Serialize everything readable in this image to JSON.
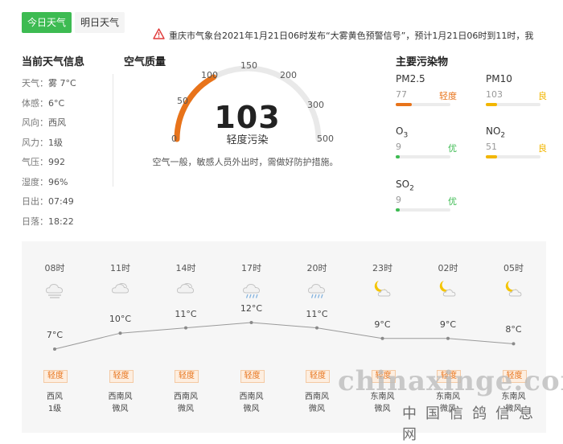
{
  "tabs": {
    "today": "今日天气",
    "tomorrow": "明日天气"
  },
  "alert": {
    "text": "重庆市气象台2021年1月21日06时发布“大雾黄色预警信号”，预计1月21日06时到11时，我"
  },
  "current": {
    "title": "当前天气信息",
    "rows": [
      {
        "label": "天气：",
        "value": "雾 7°C"
      },
      {
        "label": "体感：",
        "value": "6°C"
      },
      {
        "label": "风向：",
        "value": "西风"
      },
      {
        "label": "风力：",
        "value": "1级"
      },
      {
        "label": "气压：",
        "value": "992"
      },
      {
        "label": "湿度：",
        "value": "96%"
      },
      {
        "label": "日出：",
        "value": "07:49"
      },
      {
        "label": "日落：",
        "value": "18:22"
      }
    ]
  },
  "aqi": {
    "title": "空气质量",
    "value": "103",
    "level": "轻度污染",
    "description": "空气一般，敏感人员外出时，需做好防护措施。",
    "ticks": [
      "0",
      "50",
      "100",
      "150",
      "200",
      "300",
      "500"
    ],
    "gauge_fraction": 0.34,
    "accent": "#e8731a"
  },
  "pollutants": {
    "title": "主要污染物",
    "items": [
      {
        "name": "PM2.5",
        "value": "77",
        "level": "轻度",
        "level_color": "#e8731a",
        "fill": 0.3
      },
      {
        "name": "PM10",
        "value": "103",
        "level": "良",
        "level_color": "#f2b600",
        "fill": 0.2
      },
      {
        "name": "O",
        "sub": "3",
        "value": "9",
        "level": "优",
        "level_color": "#3dbb52",
        "fill": 0.08
      },
      {
        "name": "NO",
        "sub": "2",
        "value": "51",
        "level": "良",
        "level_color": "#f2b600",
        "fill": 0.2
      },
      {
        "name": "SO",
        "sub": "2",
        "value": "9",
        "level": "优",
        "level_color": "#3dbb52",
        "fill": 0.08
      }
    ]
  },
  "forecast": [
    {
      "time": "08时",
      "icon": "fog-icon",
      "temp": "7°C",
      "temp_c": 7,
      "aqi": "轻度",
      "wind_dir": "西风",
      "wind_lvl": "1级"
    },
    {
      "time": "11时",
      "icon": "cloudy-icon",
      "temp": "10°C",
      "temp_c": 10,
      "aqi": "轻度",
      "wind_dir": "西南风",
      "wind_lvl": "微风"
    },
    {
      "time": "14时",
      "icon": "cloudy-icon",
      "temp": "11°C",
      "temp_c": 11,
      "aqi": "轻度",
      "wind_dir": "西南风",
      "wind_lvl": "微风"
    },
    {
      "time": "17时",
      "icon": "light-rain-icon",
      "temp": "12°C",
      "temp_c": 12,
      "aqi": "轻度",
      "wind_dir": "西南风",
      "wind_lvl": "微风"
    },
    {
      "time": "20时",
      "icon": "light-rain-icon",
      "temp": "11°C",
      "temp_c": 11,
      "aqi": "轻度",
      "wind_dir": "西南风",
      "wind_lvl": "微风"
    },
    {
      "time": "23时",
      "icon": "moon-cloud-icon",
      "temp": "9°C",
      "temp_c": 9,
      "aqi": "轻度",
      "wind_dir": "东南风",
      "wind_lvl": "微风"
    },
    {
      "time": "02时",
      "icon": "moon-cloud-icon",
      "temp": "9°C",
      "temp_c": 9,
      "aqi": "轻度",
      "wind_dir": "东南风",
      "wind_lvl": "微风"
    },
    {
      "time": "05时",
      "icon": "moon-cloud-icon",
      "temp": "8°C",
      "temp_c": 8,
      "aqi": "轻度",
      "wind_dir": "东南风",
      "wind_lvl": "微风"
    }
  ],
  "watermark": {
    "latin": "chinaxinge.com",
    "chinese": "中国信鸽信息网"
  },
  "colors": {
    "brand_green": "#3dbb52",
    "orange": "#e8731a",
    "yellow": "#f2b600",
    "alert_red": "#e03a3a"
  }
}
